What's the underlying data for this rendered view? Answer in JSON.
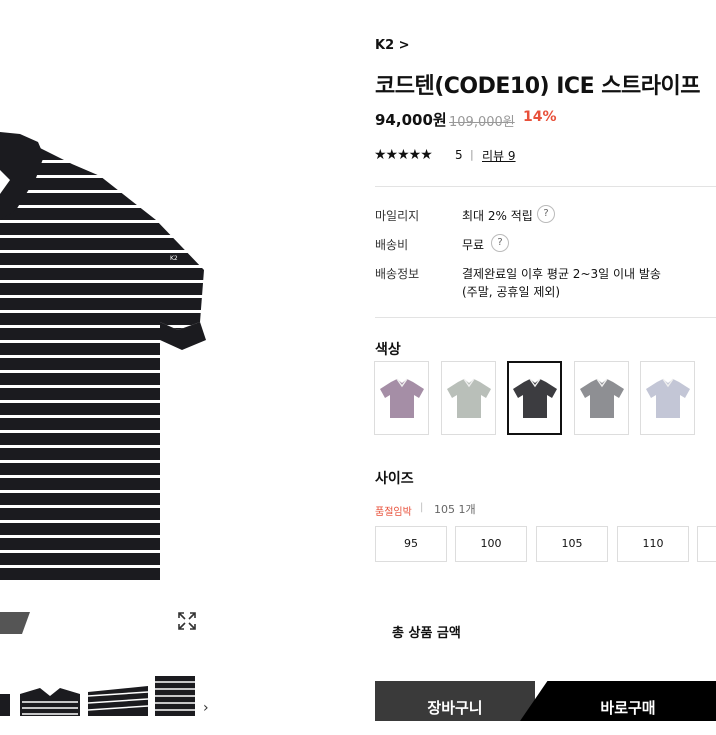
{
  "brand": {
    "label": "K2 >"
  },
  "product": {
    "title": "코드텐(CODE10) ICE 스트라이프",
    "sale_price": "94,000원",
    "original_price": "109,000원",
    "discount": "14%"
  },
  "rating": {
    "stars": "★★★★★",
    "value": 5,
    "score": "5",
    "separator": "|",
    "review_link": "리뷰 9"
  },
  "info": {
    "mileage_label": "마일리지",
    "mileage_value": "최대 2% 적립",
    "shipping_fee_label": "배송비",
    "shipping_fee_value": "무료",
    "shipping_info_label": "배송정보",
    "shipping_info_line1": "결제완료일 이후 평균 2~3일 이내 발송",
    "shipping_info_line2": "(주말, 공휴일 제외)",
    "help_glyph": "?"
  },
  "color": {
    "heading": "색상",
    "swatches": [
      {
        "color": "#a58ea6"
      },
      {
        "color": "#b9bfb9"
      },
      {
        "color": "#3c3c40",
        "selected": true
      },
      {
        "color": "#8e8f93"
      },
      {
        "color": "#c3c6d6"
      }
    ]
  },
  "size": {
    "heading": "사이즈",
    "soldout_label": "품절임박",
    "soldout_separator": "|",
    "soldout_detail": "105 1개",
    "options": [
      "95",
      "100",
      "105",
      "110"
    ]
  },
  "total": {
    "label": "총 상품 금액"
  },
  "actions": {
    "cart": "장바구니",
    "buy": "바로구매"
  },
  "gallery": {
    "zoom_icon": "expand-icon",
    "next_glyph": "›",
    "logo_text": "K2"
  },
  "colors": {
    "accent_red": "#e8503a",
    "dark": "#111111"
  }
}
